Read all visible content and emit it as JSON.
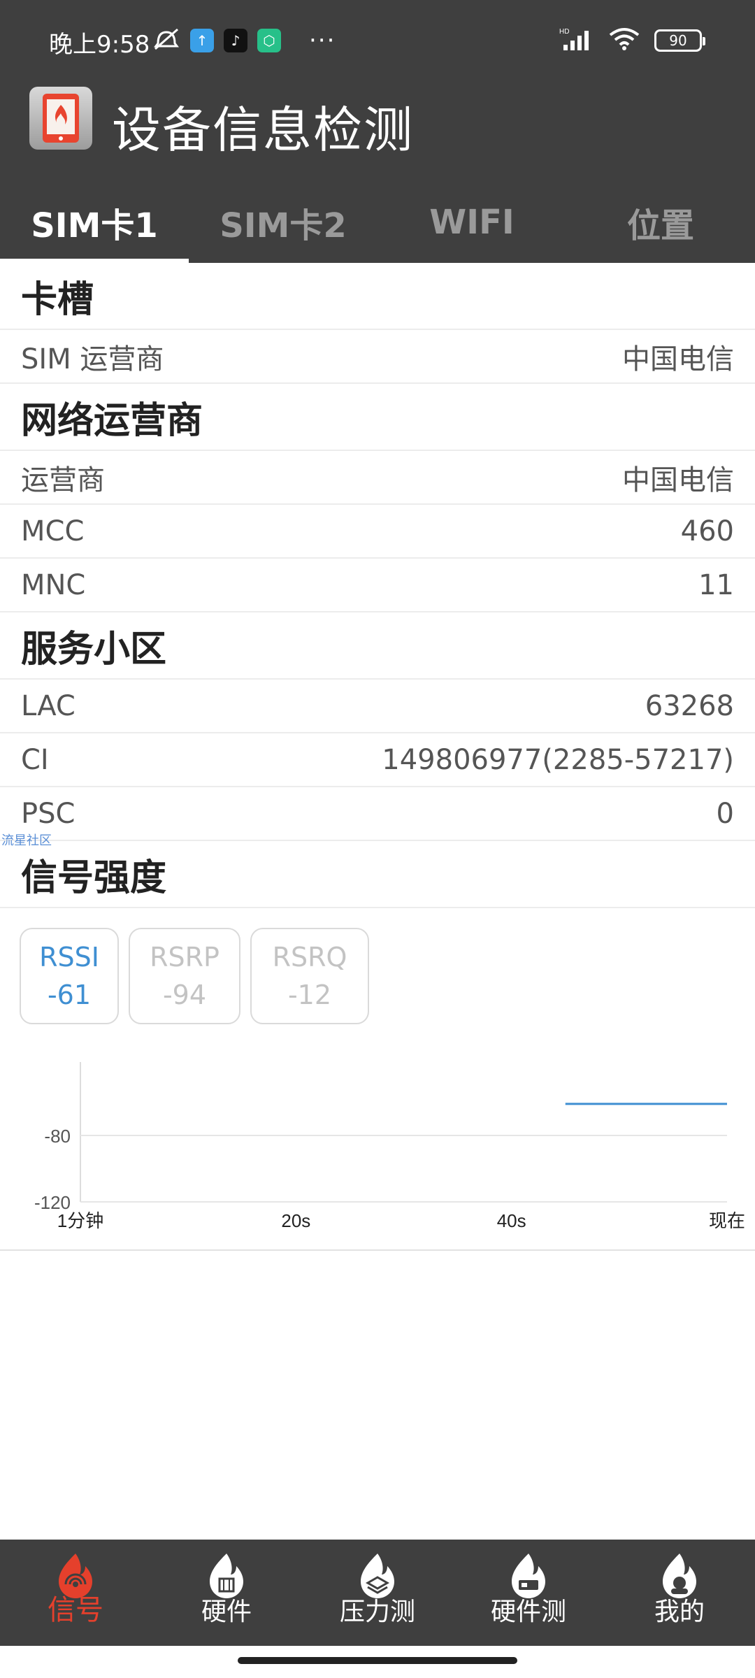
{
  "status_bar": {
    "time": "晚上9:58",
    "battery": "90",
    "network": "HD"
  },
  "app": {
    "title": "设备信息检测"
  },
  "tabs": [
    {
      "label": "SIM卡1",
      "active": true
    },
    {
      "label": "SIM卡2",
      "active": false
    },
    {
      "label": "WIFI",
      "active": false
    },
    {
      "label": "位置",
      "active": false
    }
  ],
  "sections": {
    "slot": {
      "title": "卡槽",
      "rows": [
        {
          "label": "SIM 运营商",
          "value": "中国电信"
        }
      ]
    },
    "network_operator": {
      "title": "网络运营商",
      "rows": [
        {
          "label": "运营商",
          "value": "中国电信"
        },
        {
          "label": "MCC",
          "value": "460"
        },
        {
          "label": "MNC",
          "value": "11"
        }
      ]
    },
    "serving_cell": {
      "title": "服务小区",
      "rows": [
        {
          "label": "LAC",
          "value": "63268"
        },
        {
          "label": "CI",
          "value": "149806977(2285-57217)"
        },
        {
          "label": "PSC",
          "value": "0"
        }
      ]
    },
    "signal": {
      "title": "信号强度"
    }
  },
  "watermark": "流星社区",
  "signal_cards": [
    {
      "name": "RSSI",
      "value": "-61",
      "active": true
    },
    {
      "name": "RSRP",
      "value": "-94",
      "active": false
    },
    {
      "name": "RSRQ",
      "value": "-12",
      "active": false
    }
  ],
  "chart_data": {
    "type": "line",
    "x_tick_labels": [
      "1分钟",
      "20s",
      "40s",
      "现在"
    ],
    "y_tick_labels": [
      "-80",
      "-120"
    ],
    "ylim": [
      -120,
      -40
    ],
    "series": [
      {
        "x": [
          45,
          60
        ],
        "values": [
          -61,
          -61
        ]
      }
    ],
    "colors": {
      "line": "#3f8fd2",
      "grid": "#e6e6e6",
      "axis": "#dddddd",
      "label": "#555555"
    }
  },
  "bottom_nav": [
    {
      "label": "信号",
      "icon": "signal-flame-icon",
      "active": true
    },
    {
      "label": "硬件",
      "icon": "hardware-flame-icon",
      "active": false
    },
    {
      "label": "压力测",
      "icon": "stress-test-flame-icon",
      "active": false
    },
    {
      "label": "硬件测",
      "icon": "hardware-test-flame-icon",
      "active": false
    },
    {
      "label": "我的",
      "icon": "profile-flame-icon",
      "active": false
    }
  ],
  "colors": {
    "header_bg": "#3f3f3f",
    "accent_blue": "#3f8fd2",
    "accent_red": "#e5402c"
  }
}
